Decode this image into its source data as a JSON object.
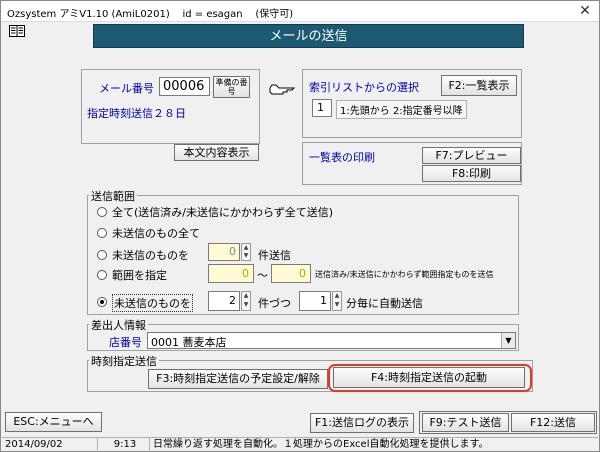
{
  "titlebar": {
    "app": "Ozsystem アミV1.10 (AmiL0201)",
    "id": "id = esagan",
    "permission": "(保守可)",
    "close": "✕"
  },
  "page_title": "メールの送信",
  "mail": {
    "number_label": "メール番号",
    "number_value": "00006",
    "prepare_button": "準備の番号",
    "scheduled": "指定時刻送信２８日",
    "body_button": "本文内容表示"
  },
  "index": {
    "label": "索引リストからの選択",
    "list_button": "F2:一覧表示",
    "mode_value": "1",
    "mode_desc": "1:先頭から 2:指定番号以降"
  },
  "print": {
    "label": "一覧表の印刷",
    "preview_button": "F7:プレビュー",
    "print_button": "F8:印刷"
  },
  "send_range": {
    "title": "送信範囲",
    "opt_all": "全て(送信済み/未送信にかかわらず全て送信)",
    "opt_unsent_all": "未送信のもの全て",
    "opt_unsent_n_label": "未送信のものを",
    "opt_unsent_n_value": "0",
    "opt_unsent_n_suffix": "件送信",
    "opt_range_label": "範囲を指定",
    "range_from": "0",
    "range_tilde": "〜",
    "range_to": "0",
    "range_note": "送信済み/未送信にかかわらず範囲指定ものを送信",
    "opt_auto_label": "未送信のものを",
    "auto_count": "2",
    "auto_count_suffix": "件づつ",
    "auto_interval": "1",
    "auto_interval_suffix": "分毎に自動送信",
    "selected": "auto"
  },
  "sender": {
    "title": "差出人情報",
    "store_label": "店番号",
    "store_value": "0001 蕎麦本店"
  },
  "schedule": {
    "title": "時刻指定送信",
    "set_button": "F3:時刻指定送信の予定設定/解除",
    "start_button": "F4:時刻指定送信の起動"
  },
  "footer": {
    "esc_button": "ESC:メニューへ",
    "log_button": "F1:送信ログの表示",
    "test_button": "F9:テスト送信",
    "send_button": "F12:送信"
  },
  "status": {
    "date": "2014/09/02",
    "time": "9:13",
    "message": "日常繰り返す処理を自動化。１処理からのExcel自動化処理を提供します。"
  },
  "colors": {
    "title_bg": "#1c5a73",
    "label_blue": "#0000b0",
    "input_yellow": "#fffbd5",
    "highlight": "#e0382b"
  }
}
